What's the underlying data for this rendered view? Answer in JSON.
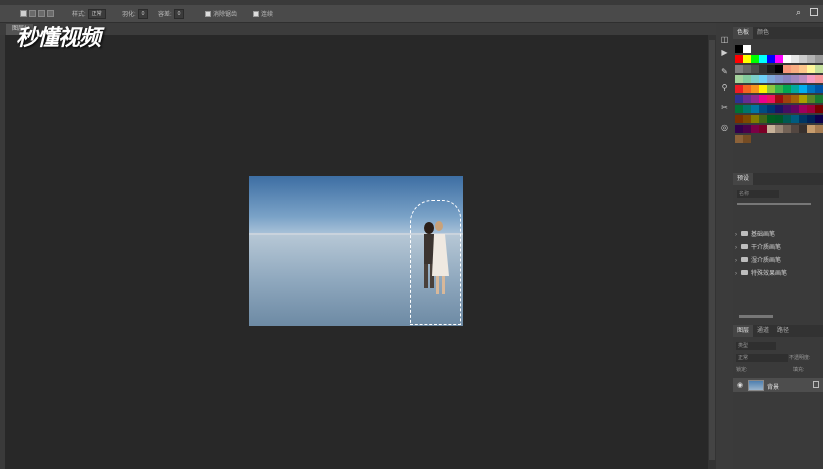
{
  "options_bar": {
    "style_label": "样式:",
    "style_value": "正常",
    "feather_label": "羽化:",
    "feather_value": "0",
    "tolerance_label": "容差:",
    "tolerance_value": "0",
    "antialias_label": "消除锯齿",
    "contiguous_label": "连续"
  },
  "document": {
    "tab_title": "图层1",
    "watermark": "秒懂视频"
  },
  "panels": {
    "swatches_tabs": [
      "色板",
      "颜色"
    ],
    "presets_tab": "预设",
    "presets_search_placeholder": "名称",
    "preset_groups": [
      "基础画笔",
      "干介质画笔",
      "湿介质画笔",
      "特殊效果画笔"
    ],
    "layers_tabs": [
      "图层",
      "通道",
      "路径"
    ],
    "layers_kind_placeholder": "类型",
    "blend_mode": "正常",
    "opacity_label": "不透明度:",
    "lock_label": "锁定:",
    "fill_label": "填充:",
    "layer_name": "背景"
  },
  "colors": {
    "ui_dark": "#282828",
    "ui_panel": "#3a3a3a",
    "selection": "#ffffff"
  }
}
